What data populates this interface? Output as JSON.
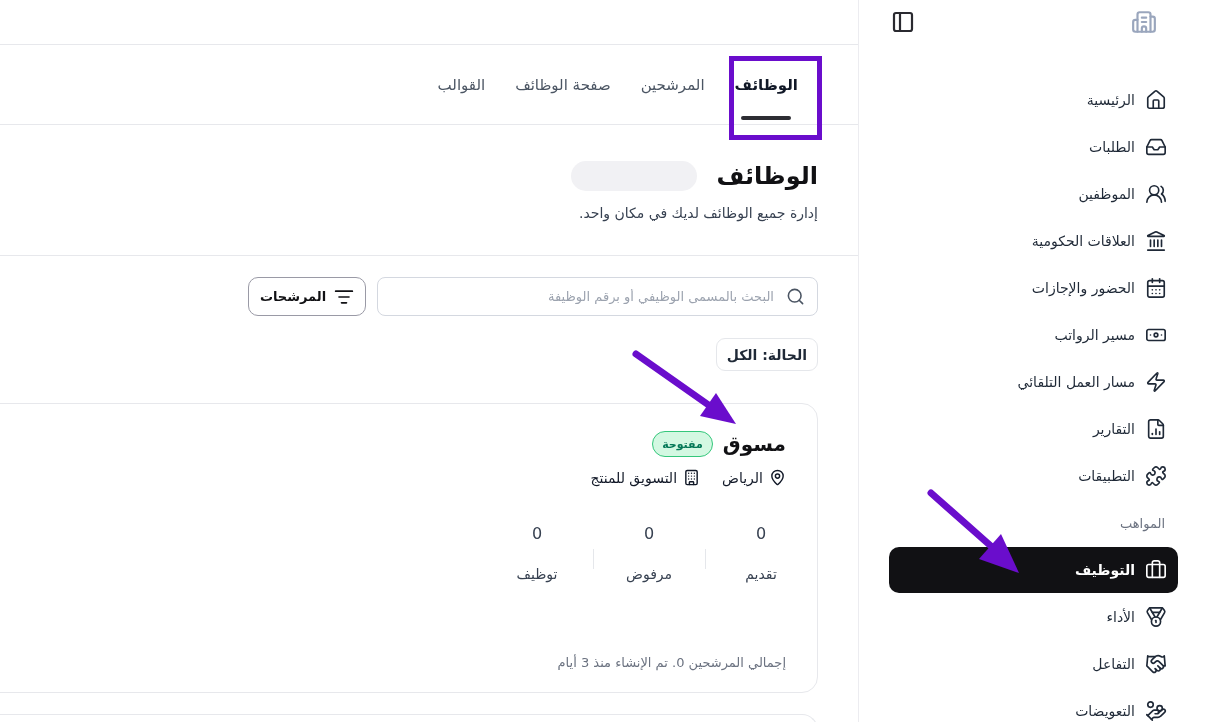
{
  "sidebar": {
    "groups": [
      {
        "items": [
          {
            "label": "الرئيسية",
            "selected": false
          },
          {
            "label": "الطلبات",
            "selected": false
          },
          {
            "label": "الموظفين",
            "selected": false
          },
          {
            "label": "العلاقات الحكومية",
            "selected": false
          },
          {
            "label": "الحضور والإجازات",
            "selected": false
          },
          {
            "label": "مسير الرواتب",
            "selected": false
          },
          {
            "label": "مسار العمل التلقائي",
            "selected": false
          },
          {
            "label": "التقارير",
            "selected": false
          },
          {
            "label": "التطبيقات",
            "selected": false
          }
        ]
      },
      {
        "heading": "المواهب",
        "items": [
          {
            "label": "التوظيف",
            "selected": true
          },
          {
            "label": "الأداء",
            "selected": false
          },
          {
            "label": "التفاعل",
            "selected": false
          },
          {
            "label": "التعويضات",
            "selected": false
          }
        ]
      }
    ]
  },
  "tabs": [
    {
      "label": "الوظائف",
      "selected": true,
      "highlighted": true
    },
    {
      "label": "المرشحين",
      "selected": false,
      "highlighted": false
    },
    {
      "label": "صفحة الوظائف",
      "selected": false,
      "highlighted": false
    },
    {
      "label": "القوالب",
      "selected": false,
      "highlighted": false
    }
  ],
  "page": {
    "title": "الوظائف",
    "subtitle": "إدارة جميع الوظائف لديك في مكان واحد."
  },
  "search": {
    "placeholder": "البحث بالمسمى الوظيفي أو برقم الوظيفة"
  },
  "filter_button": "المرشحات",
  "status_filter": "الحالة: الكل",
  "jobs": [
    {
      "title": "مسوق",
      "status": "مفتوحة",
      "location": "الرياض",
      "department": "التسويق للمنتج",
      "stats": [
        {
          "value": "0",
          "label": "تقديم"
        },
        {
          "value": "0",
          "label": "مرفوض"
        },
        {
          "value": "0",
          "label": "توظيف"
        }
      ],
      "footer": "إجمالي المرشحين 0. تم الإنشاء منذ 3 أيام"
    }
  ]
}
